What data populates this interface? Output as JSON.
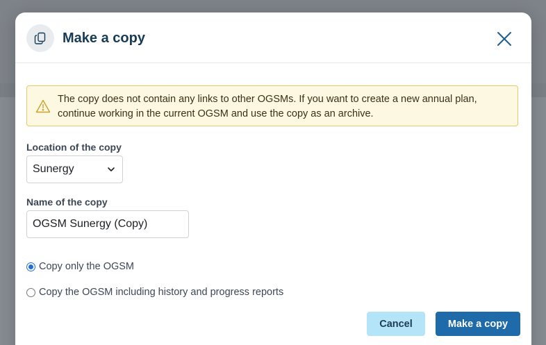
{
  "dialog": {
    "title": "Make a copy",
    "header_icon": "copy-icon",
    "close_icon": "close-icon"
  },
  "alert": {
    "icon": "warning-icon",
    "message": "The copy does not contain any links to other OGSMs. If you want to create a new annual plan, continue working in the current OGSM and use the copy as an archive."
  },
  "location": {
    "label": "Location of the copy",
    "selected": "Sunergy"
  },
  "name": {
    "label": "Name of the copy",
    "value": "OGSM Sunergy (Copy)"
  },
  "options": [
    {
      "label": "Copy only the OGSM",
      "checked": true
    },
    {
      "label": "Copy the OGSM including history and progress reports",
      "checked": false
    }
  ],
  "buttons": {
    "cancel": "Cancel",
    "submit": "Make a copy"
  },
  "colors": {
    "title": "#173a55",
    "primary": "#1f6aa8",
    "secondary": "#b4e4f7",
    "alert_bg": "#fdf8e1",
    "alert_border": "#e6c96a"
  }
}
